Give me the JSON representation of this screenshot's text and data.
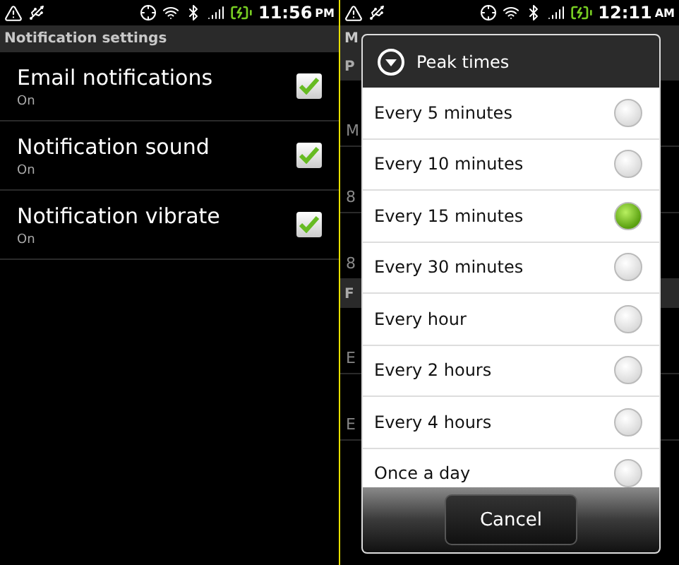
{
  "left_screen": {
    "status_bar": {
      "time": "11:56",
      "meridiem": "PM"
    },
    "title": "Notification settings",
    "settings": [
      {
        "title": "Email notifications",
        "summary": "On",
        "checked": true
      },
      {
        "title": "Notification sound",
        "summary": "On",
        "checked": true
      },
      {
        "title": "Notification vibrate",
        "summary": "On",
        "checked": true
      }
    ]
  },
  "right_screen": {
    "status_bar": {
      "time": "12:11",
      "meridiem": "AM"
    },
    "background": {
      "title": "M",
      "sections": [
        {
          "header": "P",
          "items": [
            {
              "summary": "M"
            },
            {
              "summary": "8"
            },
            {
              "summary": "8"
            }
          ]
        },
        {
          "header": "F",
          "items": [
            {
              "summary": "E"
            },
            {
              "summary": "E"
            }
          ]
        }
      ]
    },
    "dialog": {
      "title": "Peak times",
      "options": [
        {
          "label": "Every 5 minutes",
          "selected": false
        },
        {
          "label": "Every 10 minutes",
          "selected": false
        },
        {
          "label": "Every 15 minutes",
          "selected": true
        },
        {
          "label": "Every 30 minutes",
          "selected": false
        },
        {
          "label": "Every hour",
          "selected": false
        },
        {
          "label": "Every 2 hours",
          "selected": false
        },
        {
          "label": "Every 4 hours",
          "selected": false
        },
        {
          "label": "Once a day",
          "selected": false
        }
      ],
      "button": "Cancel"
    }
  }
}
